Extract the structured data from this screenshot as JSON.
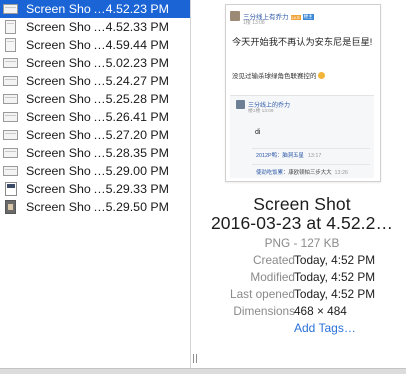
{
  "files": [
    {
      "name": "Screen Sho",
      "time": "…4.52.23 PM",
      "thumb": "landscape",
      "selected": true
    },
    {
      "name": "Screen Sho",
      "time": "…4.52.33 PM",
      "thumb": "portrait"
    },
    {
      "name": "Screen Sho",
      "time": "…4.59.44 PM",
      "thumb": "portrait"
    },
    {
      "name": "Screen Sho",
      "time": "…5.02.23 PM",
      "thumb": "landscape"
    },
    {
      "name": "Screen Sho",
      "time": "…5.24.27 PM",
      "thumb": "landscape"
    },
    {
      "name": "Screen Sho",
      "time": "…5.25.28 PM",
      "thumb": "landscape"
    },
    {
      "name": "Screen Sho",
      "time": "…5.26.41 PM",
      "thumb": "landscape"
    },
    {
      "name": "Screen Sho",
      "time": "…5.27.20 PM",
      "thumb": "landscape"
    },
    {
      "name": "Screen Sho",
      "time": "…5.28.35 PM",
      "thumb": "landscape"
    },
    {
      "name": "Screen Sho",
      "time": "…5.29.00 PM",
      "thumb": "landscape"
    },
    {
      "name": "Screen Sho",
      "time": "…5.29.33 PM",
      "thumb": "sheet"
    },
    {
      "name": "Screen Sho",
      "time": "…5.29.50 PM",
      "thumb": "dark"
    }
  ],
  "preview_image": {
    "user": "三分线上有乔力",
    "badge_level": "Lv.6",
    "badge_role": "楼主",
    "meta": "1楼 13:08",
    "content": "今天开始我不再认为安东尼是巨星!",
    "content_line2": "没见过输杀球绿角色联赛控的",
    "quote_user": "三分线上的乔力",
    "quote_meta": "楼1楼 13:09",
    "quote_text": "di",
    "reply1": "2012P鸭：脑洞五星",
    "reply1_time": "13:17",
    "reply2_user": "使劲吃饭累",
    "reply2_text": "：康欧顿帕三步大大",
    "reply2_time": "13:26"
  },
  "file_info": {
    "title_line1": "Screen Shot",
    "title_line2": "2016-03-23 at 4.52.2…",
    "kind": "PNG - 127 KB",
    "created_label": "Created",
    "created_value": "Today, 4:52 PM",
    "modified_label": "Modified",
    "modified_value": "Today, 4:52 PM",
    "last_opened_label": "Last opened",
    "last_opened_value": "Today, 4:52 PM",
    "dimensions_label": "Dimensions",
    "dimensions_value": "468 × 484",
    "add_tags": "Add Tags…"
  },
  "colors": {
    "selection": "#1a64d6",
    "link": "#2a73d9",
    "label_gray": "#8a8a8a"
  }
}
